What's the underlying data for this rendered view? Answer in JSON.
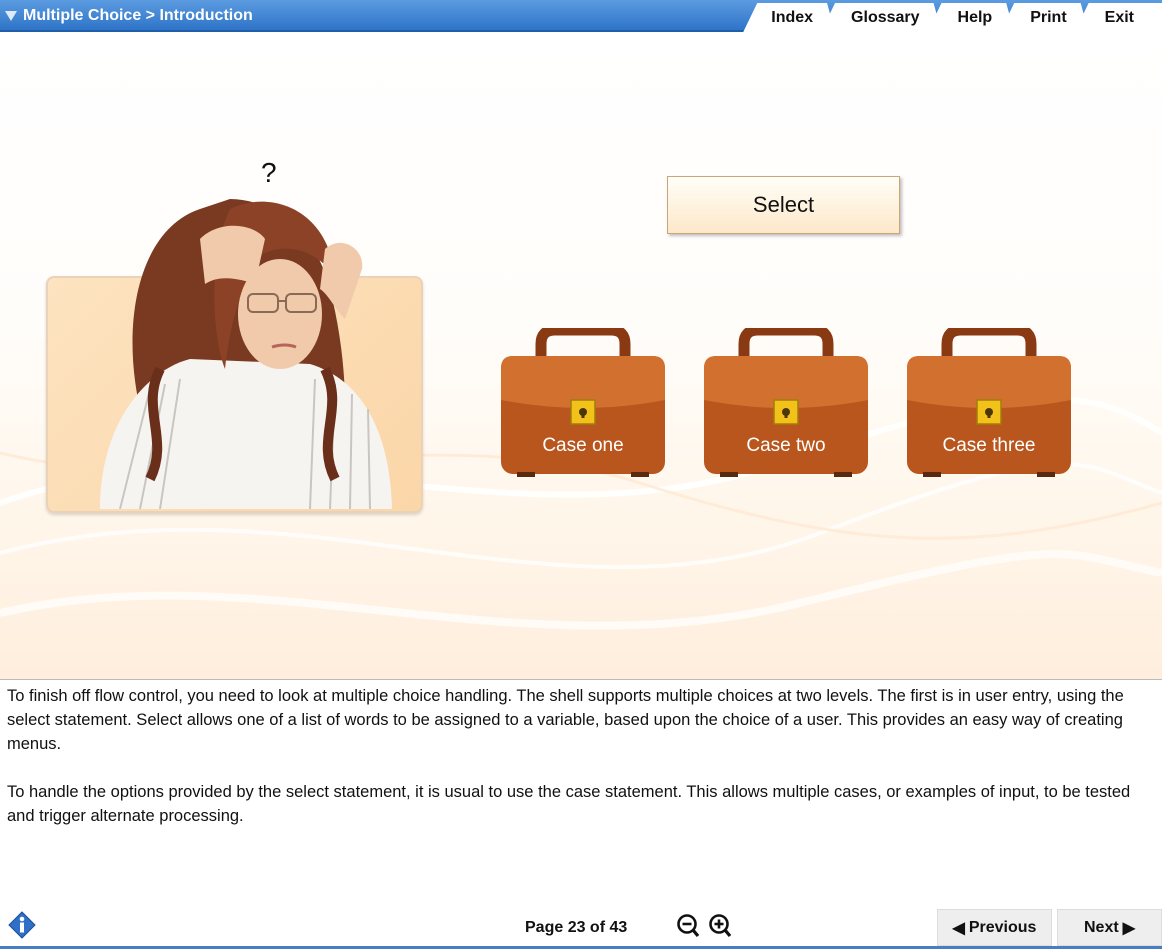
{
  "header": {
    "breadcrumb": "Multiple Choice > Introduction",
    "tabs": [
      {
        "label": "Index"
      },
      {
        "label": "Glossary"
      },
      {
        "label": "Help"
      },
      {
        "label": "Print"
      },
      {
        "label": "Exit"
      }
    ]
  },
  "stage": {
    "question_mark": "?",
    "select_label": "Select",
    "cases": [
      {
        "label": "Case one"
      },
      {
        "label": "Case two"
      },
      {
        "label": "Case three"
      }
    ]
  },
  "body": {
    "paragraphs": [
      "To finish off flow control, you need to look at multiple choice handling. The shell supports multiple choices at two levels. The first is in user entry, using the select statement. Select allows one of a list of words to be assigned to a variable, based upon the choice of a user. This provides an easy way of creating menus.",
      "To handle the options provided by the select statement, it is usual to use the case statement. This allows multiple cases, or examples of input, to be tested and trigger alternate processing."
    ]
  },
  "footer": {
    "page_label": "Page 23 of 43",
    "previous_label": "Previous",
    "next_label": "Next"
  },
  "colors": {
    "header_blue": "#2f74c8",
    "case_brown": "#b5541c",
    "lock_gold": "#f2c21a"
  },
  "icons": [
    "info-icon",
    "zoom-out-icon",
    "zoom-in-icon",
    "lock-icon",
    "triangle-down-icon"
  ]
}
